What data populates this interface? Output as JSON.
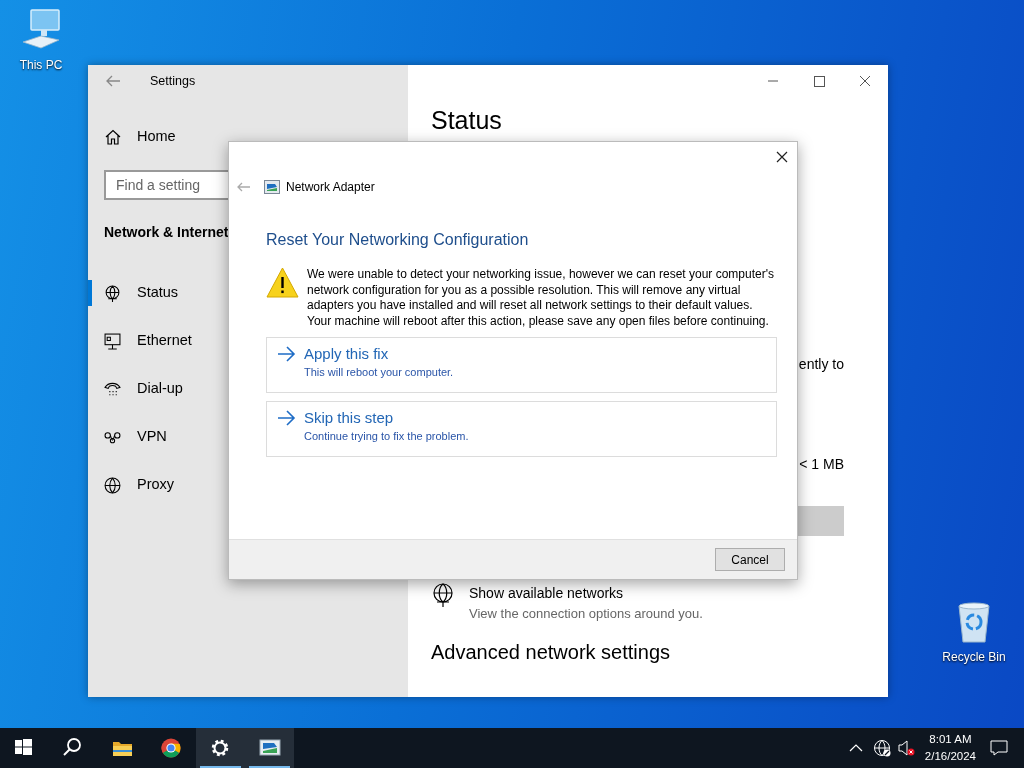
{
  "desktop_icons": [
    {
      "kind": "computer",
      "label": "This PC"
    },
    {
      "kind": "recycle",
      "label": "Recycle Bin"
    }
  ],
  "settings_window": {
    "title": "Settings",
    "sidebar": {
      "home": "Home",
      "search": {
        "placeholder": "Find a setting"
      },
      "section": "Network & Internet",
      "items": [
        {
          "kind": "status",
          "label": "Status",
          "selected": true
        },
        {
          "kind": "ethernet",
          "label": "Ethernet",
          "selected": false
        },
        {
          "kind": "dialup",
          "label": "Dial-up",
          "selected": false
        },
        {
          "kind": "vpn",
          "label": "VPN",
          "selected": false
        },
        {
          "kind": "proxy",
          "label": "Proxy",
          "selected": false
        }
      ]
    },
    "main": {
      "heading": "Status",
      "partial_texts": [
        "ently to",
        "< 1 MB"
      ],
      "show_networks": {
        "title": "Show available networks",
        "subtitle": "View the connection options around you."
      },
      "section_heading": "Advanced network settings"
    }
  },
  "dialog": {
    "title": "Network Adapter",
    "heading": "Reset Your Networking Configuration",
    "message": "We were unable to detect your networking issue, however we can reset your computer's network configuration for you as a possible resolution. This will remove any virtual adapters you have installed and will reset all network settings to their default values. Your machine will reboot after this action, please save any open files before continuing.",
    "options": [
      {
        "title": "Apply this fix",
        "subtitle": "This will reboot your computer."
      },
      {
        "title": "Skip this step",
        "subtitle": "Continue trying to fix the problem."
      }
    ],
    "cancel": "Cancel"
  },
  "taskbar": {
    "apps": [
      {
        "kind": "start",
        "active": false
      },
      {
        "kind": "search",
        "active": false
      },
      {
        "kind": "explorer",
        "active": false
      },
      {
        "kind": "chrome",
        "active": false
      },
      {
        "kind": "settings",
        "active": true
      },
      {
        "kind": "adapter",
        "active": true
      }
    ],
    "clock": {
      "time": "8:01 AM",
      "date": "2/16/2024"
    }
  }
}
